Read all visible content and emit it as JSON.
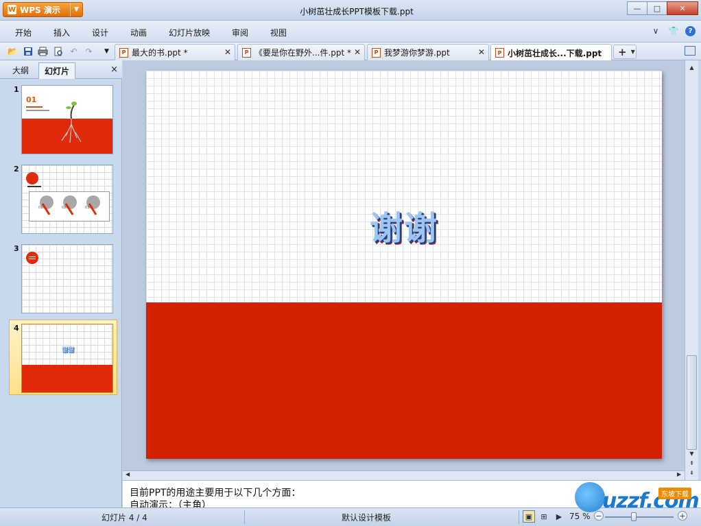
{
  "app": {
    "brand_label": "WPS 演示",
    "logo_glyph": "W",
    "window_title": "小树茁壮成长PPT模板下载.ppt",
    "window_buttons": {
      "minimize": "—",
      "maximize": "□",
      "close": "✕"
    }
  },
  "menu": {
    "items": [
      "开始",
      "插入",
      "设计",
      "动画",
      "幻灯片放映",
      "审阅",
      "视图"
    ],
    "right": {
      "collapse": "∨",
      "skin": "👕",
      "help": "?"
    }
  },
  "toolbar": {
    "quick_access": [
      "open-icon",
      "save-icon",
      "print-icon",
      "print-preview-icon",
      "undo-icon",
      "redo-icon",
      "customize-icon"
    ]
  },
  "document_tabs": [
    {
      "label": "最大的书.ppt *",
      "active": false
    },
    {
      "label": "《要是你在野外...件.ppt *",
      "active": false
    },
    {
      "label": "我梦游你梦游.ppt",
      "active": false
    },
    {
      "label": "小树茁壮成长...下载.ppt",
      "active": true
    }
  ],
  "left_panel": {
    "tabs": [
      "大纲",
      "幻灯片"
    ],
    "active_tab": "幻灯片",
    "close": "×",
    "slides": [
      {
        "number": "1",
        "heading": "01"
      },
      {
        "number": "2",
        "labels": [
          "01",
          "02",
          "03"
        ]
      },
      {
        "number": "3"
      },
      {
        "number": "4",
        "selected": true
      }
    ]
  },
  "slide": {
    "title": "谢谢",
    "colors": {
      "red": "#d32100",
      "grid": "#e3e3e3"
    }
  },
  "notes": {
    "lines": [
      "目前PPT的用途主要用于以下几个方面：",
      "自动演示：（主角）"
    ]
  },
  "status": {
    "slide_counter": "幻灯片 4 / 4",
    "template": "默认设计模板",
    "zoom": "75 %"
  },
  "watermark": {
    "text": "uzzf.com",
    "badge": "东坡下载"
  }
}
